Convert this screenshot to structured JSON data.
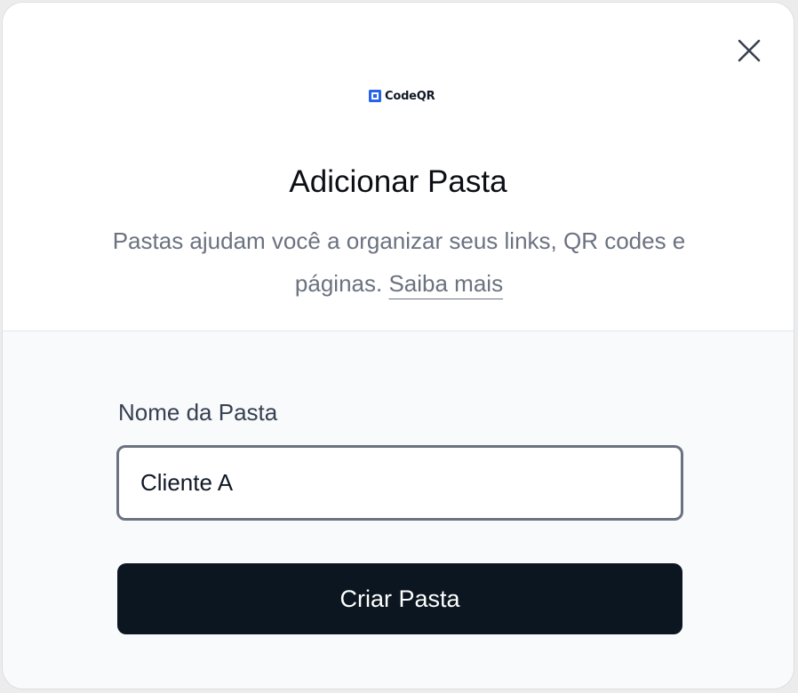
{
  "modal": {
    "logo_text": "CodeQR",
    "title": "Adicionar Pasta",
    "description": "Pastas ajudam você a organizar seus links, QR codes e páginas.",
    "learn_more_label": "Saiba mais",
    "close_icon": "close-icon"
  },
  "form": {
    "folder_name_label": "Nome da Pasta",
    "folder_name_value": "Cliente A",
    "submit_label": "Criar Pasta"
  },
  "colors": {
    "accent": "#2563eb",
    "button_bg": "#0b1620",
    "footer_bg": "#f8fafc"
  }
}
